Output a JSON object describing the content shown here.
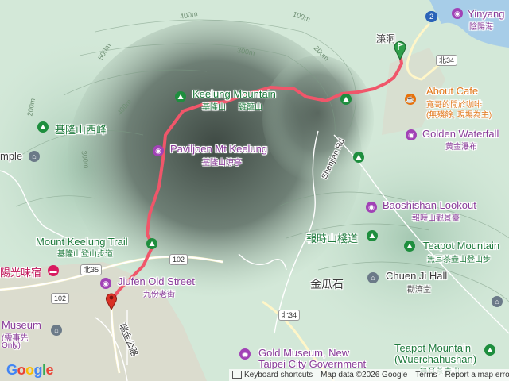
{
  "labels": {
    "keelung_mountain_en": "Keelung Mountain",
    "keelung_mountain_zh": "雞籠山",
    "keelung_mountain_zh_partial": "基隆山",
    "keelung_west_peak": "基隆山西峰",
    "pavilion_en": "Paviljoen Mt Keelung",
    "pavilion_zh": "基隆山涼亭",
    "trail_en": "Mount Keelung Trail",
    "trail_zh": "基隆山登山步道",
    "old_street_en": "Jiufen Old Street",
    "old_street_zh": "九份老街",
    "about_cafe_en": "About Cafe",
    "about_cafe_zh1": "寬哥的閒於咖啡",
    "about_cafe_zh2": "(無殘餘, 現場為主)",
    "golden_waterfall_en": "Golden Waterfall",
    "golden_waterfall_zh": "黃金瀑布",
    "baoshishan_en": "Baoshishan Lookout",
    "baoshishan_zh": "報時山觀景臺",
    "baoshishan_trail_zh": "報時山棧道",
    "teapot_mountain_en": "Teapot Mountain",
    "teapot_mountain_zh": "無耳茶壺山登山步",
    "chuen_ji_hall_en": "Chuen Ji Hall",
    "chuen_ji_hall_zh": "勸濟堂",
    "jinguashi": "金瓜石",
    "gold_museum_en1": "Gold Museum, New",
    "gold_museum_en2": "Taipei City Government",
    "teapot_wuer_en1": "Teapot Mountain",
    "teapot_wuer_en2": "(Wuerchahushan)",
    "teapot_wuer_zh": "無耳茶壺山",
    "lian_dong": "濂洞",
    "yinyang_en": "Yinyang",
    "yinyang_zh": "陰陽海",
    "shanjian_rd": "Shanjian Rd",
    "museum_left_en": "Museum",
    "museum_left_zh": "(需事先",
    "museum_left_sub": "Only)",
    "guanyin_left": "mple",
    "yang_guang": "陽光味宿",
    "jinshi_road": "瑞金公路"
  },
  "road_shields": {
    "route_2": "2",
    "beo34_top": "北34",
    "beo34_bottom": "北34",
    "beo35": "北35",
    "route_102_left": "102",
    "route_102_mid": "102"
  },
  "contours": [
    "100m",
    "200m",
    "300m",
    "400m",
    "500m",
    "100m",
    "200m",
    "200m",
    "300m",
    "400m"
  ],
  "footer": {
    "keyboard": "Keyboard shortcuts",
    "map_data": "Map data ©2026 Google",
    "terms": "Terms",
    "report": "Report a map error"
  },
  "colors": {
    "route": "#f0566a",
    "start_pin": "#2e9e4a",
    "end_pin": "#d93025",
    "water": "#a7cde8"
  },
  "icons": {
    "start": "green-flag-pin-icon",
    "end": "red-location-pin-icon",
    "hiking": "hiker-icon",
    "camera": "camera-icon",
    "cafe": "coffee-icon",
    "landmark": "landmark-icon",
    "hotel": "bed-icon",
    "museum": "museum-icon"
  }
}
